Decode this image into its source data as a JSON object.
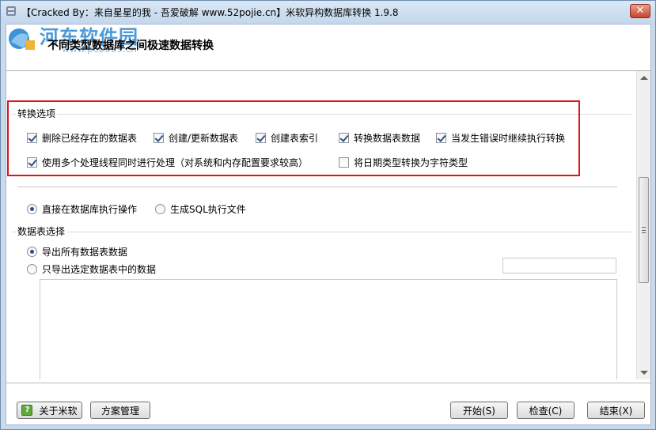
{
  "window": {
    "title": "【Cracked By：来自星星的我 - 吾爱破解 www.52pojie.cn】米软异构数据库转换 1.9.8",
    "close_glyph": "✕"
  },
  "header": {
    "watermark": "河东软件园",
    "watermark_url": "www.pc0359.cn",
    "title": "不同类型数据库之间极速数据转换"
  },
  "options": {
    "group_title": "转换选项",
    "items": [
      {
        "label": "删除已经存在的数据表",
        "checked": true
      },
      {
        "label": "创建/更新数据表",
        "checked": true
      },
      {
        "label": "创建表索引",
        "checked": true
      },
      {
        "label": "转换数据表数据",
        "checked": true
      },
      {
        "label": "当发生错误时继续执行转换",
        "checked": true
      },
      {
        "label": "使用多个处理线程同时进行处理（对系统和内存配置要求较高）",
        "checked": true
      },
      {
        "label": "将日期类型转换为字符类型",
        "checked": false
      }
    ],
    "highlight_color": "#e0151c"
  },
  "mode": {
    "direct": "直接在数据库执行操作",
    "sql_file": "生成SQL执行文件",
    "selected": "direct"
  },
  "tables": {
    "group_title": "数据表选择",
    "all": "导出所有数据表数据",
    "selected_only": "只导出选定数据表中的数据",
    "selected": "all",
    "filter_value": ""
  },
  "footer": {
    "about": "关于米软",
    "plans": "方案管理",
    "start": "开始(S)",
    "check": "检查(C)",
    "finish": "结束(X)"
  }
}
